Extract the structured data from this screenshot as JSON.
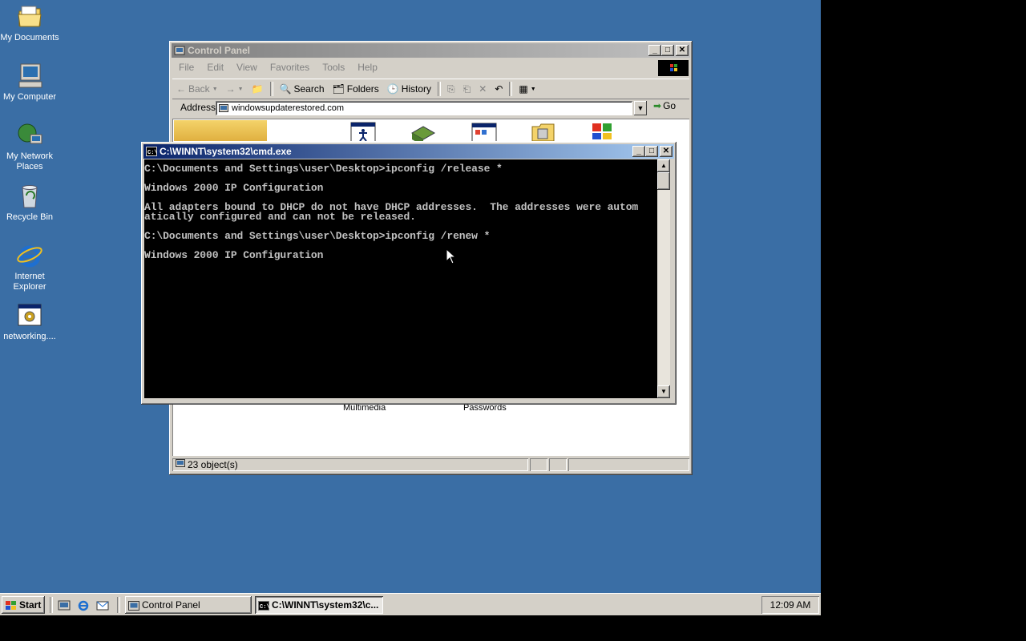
{
  "desktop": {
    "icons": [
      {
        "label": "My Documents"
      },
      {
        "label": "My Computer"
      },
      {
        "label": "My Network Places"
      },
      {
        "label": "Recycle Bin"
      },
      {
        "label": "Internet Explorer"
      },
      {
        "label": "networking...."
      }
    ]
  },
  "control_panel": {
    "title": "Control Panel",
    "menu": [
      "File",
      "Edit",
      "View",
      "Favorites",
      "Tools",
      "Help"
    ],
    "toolbar": {
      "back": "Back",
      "search": "Search",
      "folders": "Folders",
      "history": "History"
    },
    "address_label": "Address",
    "address_value": "windowsupdaterestored.com",
    "go_label": "Go",
    "visible_items": [
      "Multimedia",
      "Passwords"
    ],
    "status": "23 object(s)"
  },
  "cmd": {
    "title": "C:\\WINNT\\system32\\cmd.exe",
    "lines": [
      "C:\\Documents and Settings\\user\\Desktop>ipconfig /release *",
      "",
      "Windows 2000 IP Configuration",
      "",
      "All adapters bound to DHCP do not have DHCP addresses.  The addresses were autom",
      "atically configured and can not be released.",
      "",
      "C:\\Documents and Settings\\user\\Desktop>ipconfig /renew *",
      "",
      "Windows 2000 IP Configuration"
    ]
  },
  "taskbar": {
    "start_label": "Start",
    "tasks": [
      {
        "label": "Control Panel",
        "active": false
      },
      {
        "label": "C:\\WINNT\\system32\\c...",
        "active": true
      }
    ],
    "clock": "12:09 AM"
  }
}
